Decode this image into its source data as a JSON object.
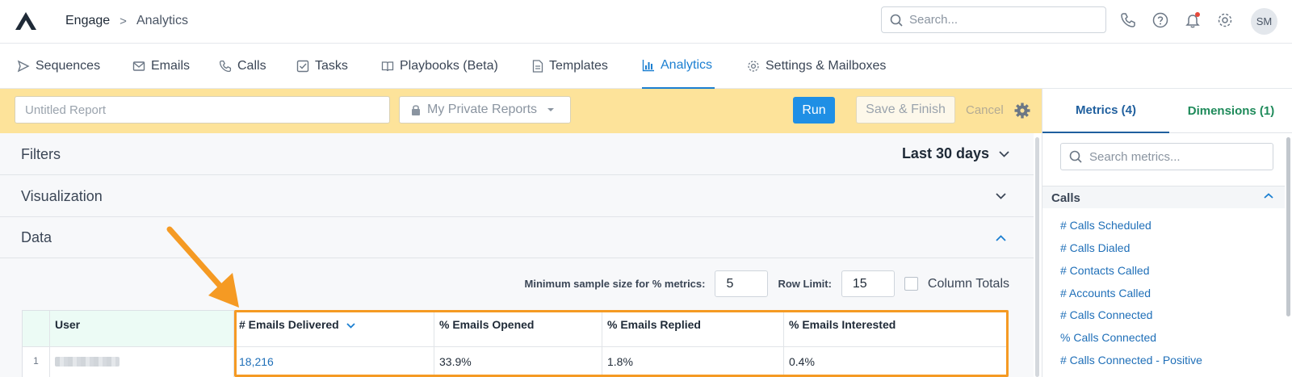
{
  "breadcrumb": {
    "app": "Engage",
    "separator": ">",
    "page": "Analytics"
  },
  "header": {
    "search_placeholder": "Search...",
    "avatar_initials": "SM"
  },
  "nav": {
    "tabs": [
      {
        "label": "Sequences",
        "icon": "send-icon"
      },
      {
        "label": "Emails",
        "icon": "envelope-icon"
      },
      {
        "label": "Calls",
        "icon": "phone-icon"
      },
      {
        "label": "Tasks",
        "icon": "checkbox-icon"
      },
      {
        "label": "Playbooks (Beta)",
        "icon": "book-icon"
      },
      {
        "label": "Templates",
        "icon": "document-icon"
      },
      {
        "label": "Analytics",
        "icon": "bar-chart-icon",
        "active": true
      },
      {
        "label": "Settings & Mailboxes",
        "icon": "gear-icon"
      }
    ]
  },
  "toolbar": {
    "report_placeholder": "Untitled Report",
    "folder": "My Private Reports",
    "run_label": "Run",
    "save_label": "Save & Finish",
    "cancel_label": "Cancel"
  },
  "sections": {
    "filters": "Filters",
    "range": "Last 30 days",
    "visualization": "Visualization",
    "data": "Data"
  },
  "options": {
    "min_sample_label": "Minimum sample size for % metrics:",
    "min_sample_value": "5",
    "row_limit_label": "Row Limit:",
    "row_limit_value": "15",
    "column_totals_label": "Column Totals"
  },
  "table": {
    "headers": [
      "User",
      "# Emails Delivered",
      "% Emails Opened",
      "% Emails Replied",
      "% Emails Interested"
    ],
    "rows": [
      {
        "index": "1",
        "delivered": "18,216",
        "opened": "33.9%",
        "replied": "1.8%",
        "interested": "0.4%"
      }
    ]
  },
  "right_panel": {
    "metrics_tab": "Metrics (4)",
    "dimensions_tab": "Dimensions (1)",
    "search_placeholder": "Search metrics...",
    "group": "Calls",
    "metrics": [
      "# Calls Scheduled",
      "# Calls Dialed",
      "# Contacts Called",
      "# Accounts Called",
      "# Calls Connected",
      "% Calls Connected",
      "# Calls Connected - Positive"
    ]
  },
  "colors": {
    "accent": "#1b7fd1",
    "toolbar": "#fde39a",
    "highlight": "#f59a23",
    "dimensions": "#1e8a5a"
  }
}
